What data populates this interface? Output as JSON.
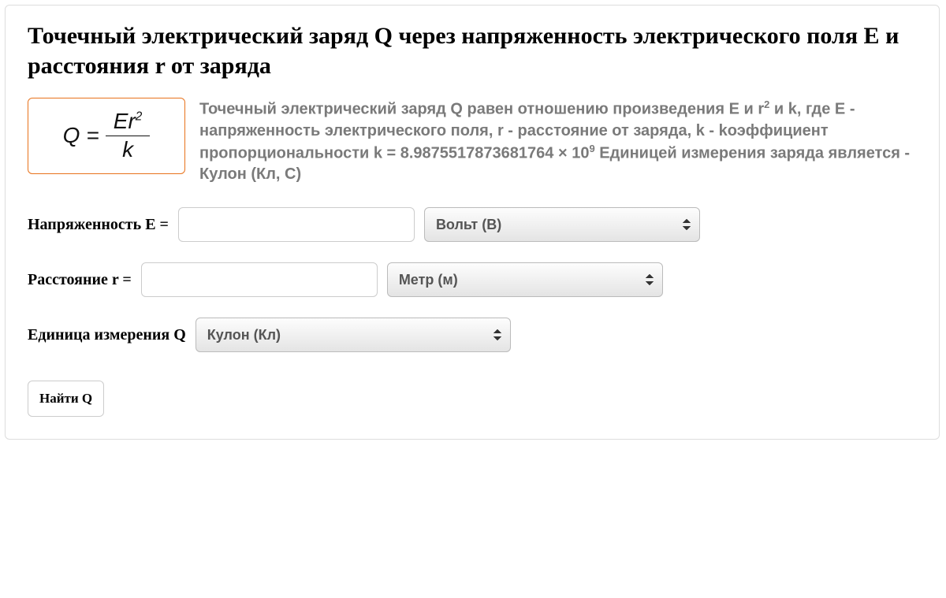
{
  "title": "Точечный электрический заряд Q через напряженность электрического поля E и расстояния r от заряда",
  "formula": {
    "lhs": "Q",
    "eq": "=",
    "numerator_html": "Er",
    "numerator_exp": "2",
    "denominator": "k"
  },
  "description": {
    "pre": "Точечный электрический заряд Q равен отношению произведения E и r",
    "r_exp": "2",
    "mid": " и k, где E - напряженность электрического поля, r - расстояние от заряда, k - kоэффициент пропорциональности k = 8.9875517873681764 × 10",
    "k_exp": "9",
    "post": " Единицей измерения заряда является - Кулон (Кл, C)"
  },
  "fields": {
    "e": {
      "label": "Напряженность E =",
      "value": "",
      "unit_selected": "Вольт (В)"
    },
    "r": {
      "label": "Расстояние r =",
      "value": "",
      "unit_selected": "Метр (м)"
    },
    "q": {
      "label": "Единица измерения Q",
      "unit_selected": "Кулон (Кл)"
    }
  },
  "submit_label": "Найти Q"
}
